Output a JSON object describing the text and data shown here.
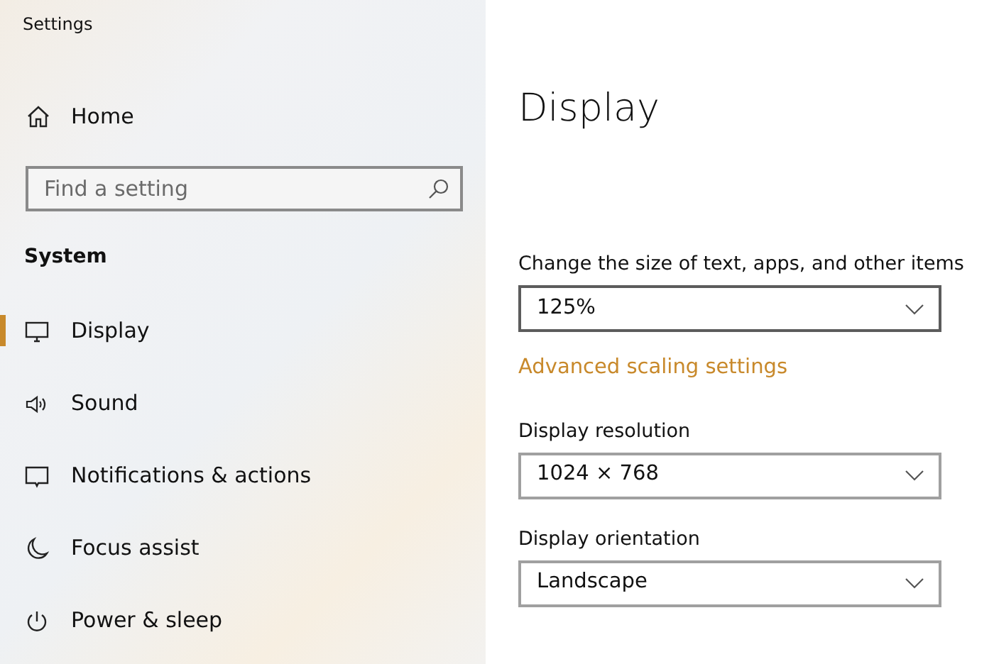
{
  "window": {
    "title": "Settings"
  },
  "sidebar": {
    "home": "Home",
    "search": {
      "placeholder": "Find a setting"
    },
    "section": "System",
    "items": [
      {
        "label": "Display",
        "selected": true
      },
      {
        "label": "Sound",
        "selected": false
      },
      {
        "label": "Notifications & actions",
        "selected": false
      },
      {
        "label": "Focus assist",
        "selected": false
      },
      {
        "label": "Power & sleep",
        "selected": false
      }
    ]
  },
  "content": {
    "heading": "Display",
    "settings": [
      {
        "kind": "dropdown",
        "label": "Change the size of text, apps, and other items",
        "value": "125%",
        "focused": true
      },
      {
        "kind": "link",
        "label": "Advanced scaling settings"
      },
      {
        "kind": "dropdown",
        "label": "Display resolution",
        "value": "1024 × 768",
        "focused": false
      },
      {
        "kind": "dropdown",
        "label": "Display orientation",
        "value": "Landscape",
        "focused": false
      }
    ]
  }
}
